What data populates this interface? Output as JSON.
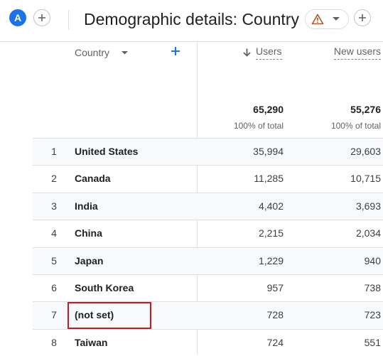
{
  "header": {
    "avatar_letter": "A",
    "title": "Demographic details: Country"
  },
  "table": {
    "dimension_header": "Country",
    "metric_headers": [
      "Users",
      "New users"
    ],
    "sort_column": "Users",
    "totals": {
      "users": "65,290",
      "users_pct": "100% of total",
      "new_users": "55,276",
      "new_users_pct": "100% of total"
    },
    "rows": [
      {
        "idx": "1",
        "country": "United States",
        "users": "35,994",
        "new_users": "29,603"
      },
      {
        "idx": "2",
        "country": "Canada",
        "users": "11,285",
        "new_users": "10,715"
      },
      {
        "idx": "3",
        "country": "India",
        "users": "4,402",
        "new_users": "3,693"
      },
      {
        "idx": "4",
        "country": "China",
        "users": "2,215",
        "new_users": "2,034"
      },
      {
        "idx": "5",
        "country": "Japan",
        "users": "1,229",
        "new_users": "940"
      },
      {
        "idx": "6",
        "country": "South Korea",
        "users": "957",
        "new_users": "738"
      },
      {
        "idx": "7",
        "country": "(not set)",
        "users": "728",
        "new_users": "723"
      },
      {
        "idx": "8",
        "country": "Taiwan",
        "users": "724",
        "new_users": "551"
      }
    ]
  },
  "colors": {
    "accent": "#1a73e8",
    "highlight": "#d0161f",
    "warning": "#b3541e"
  }
}
